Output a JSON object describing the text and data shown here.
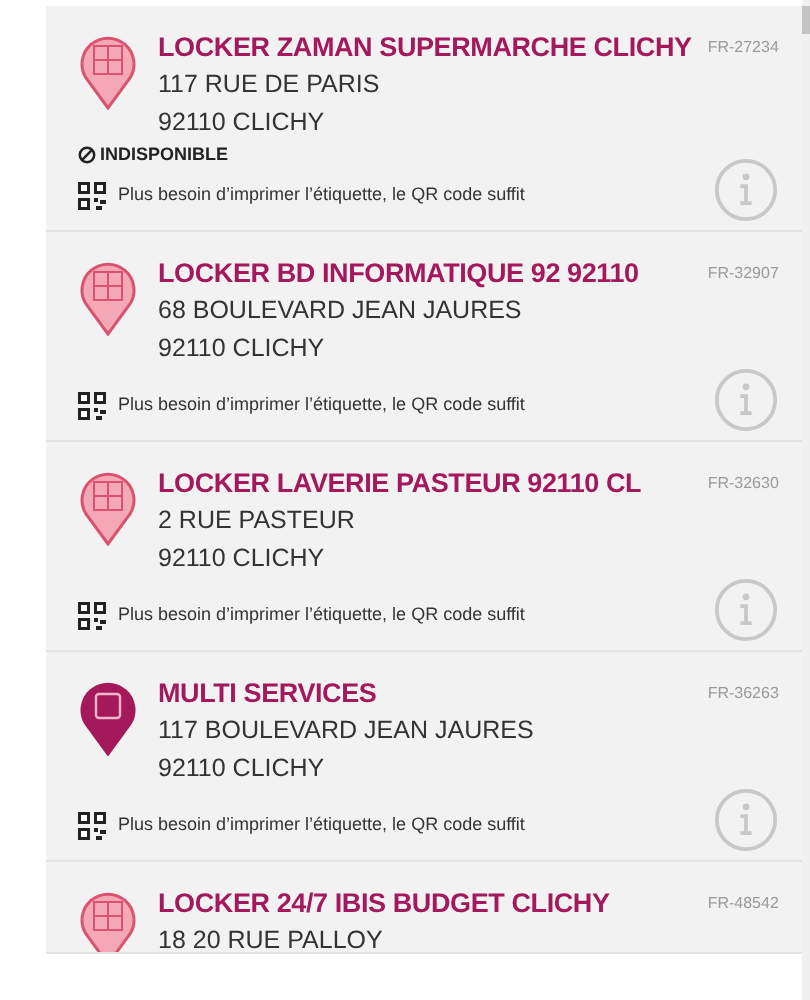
{
  "points": [
    {
      "kind": "locker",
      "name": "LOCKER ZAMAN SUPERMARCHE CLICHY",
      "code": "FR-27234",
      "address": [
        "117 RUE DE PARIS",
        "92110 CLICHY"
      ],
      "unavailable": "INDISPONIBLE",
      "qr_note": "Plus besoin d’imprimer l’étiquette, le QR code suffit"
    },
    {
      "kind": "locker",
      "name": "LOCKER BD INFORMATIQUE 92 92110",
      "code": "FR-32907",
      "address": [
        "68 BOULEVARD JEAN JAURES",
        "92110 CLICHY"
      ],
      "qr_note": "Plus besoin d’imprimer l’étiquette, le QR code suffit"
    },
    {
      "kind": "locker",
      "name": "LOCKER LAVERIE PASTEUR 92110 CL",
      "code": "FR-32630",
      "address": [
        "2 RUE PASTEUR",
        "92110 CLICHY"
      ],
      "qr_note": "Plus besoin d’imprimer l’étiquette, le QR code suffit"
    },
    {
      "kind": "shop",
      "name": "MULTI SERVICES",
      "code": "FR-36263",
      "address": [
        "117 BOULEVARD JEAN JAURES",
        "92110 CLICHY"
      ],
      "qr_note": "Plus besoin d’imprimer l’étiquette, le QR code suffit"
    },
    {
      "kind": "locker",
      "name": "LOCKER 24/7 IBIS BUDGET CLICHY",
      "code": "FR-48542",
      "address": [
        "18 20 RUE PALLOY"
      ]
    }
  ]
}
